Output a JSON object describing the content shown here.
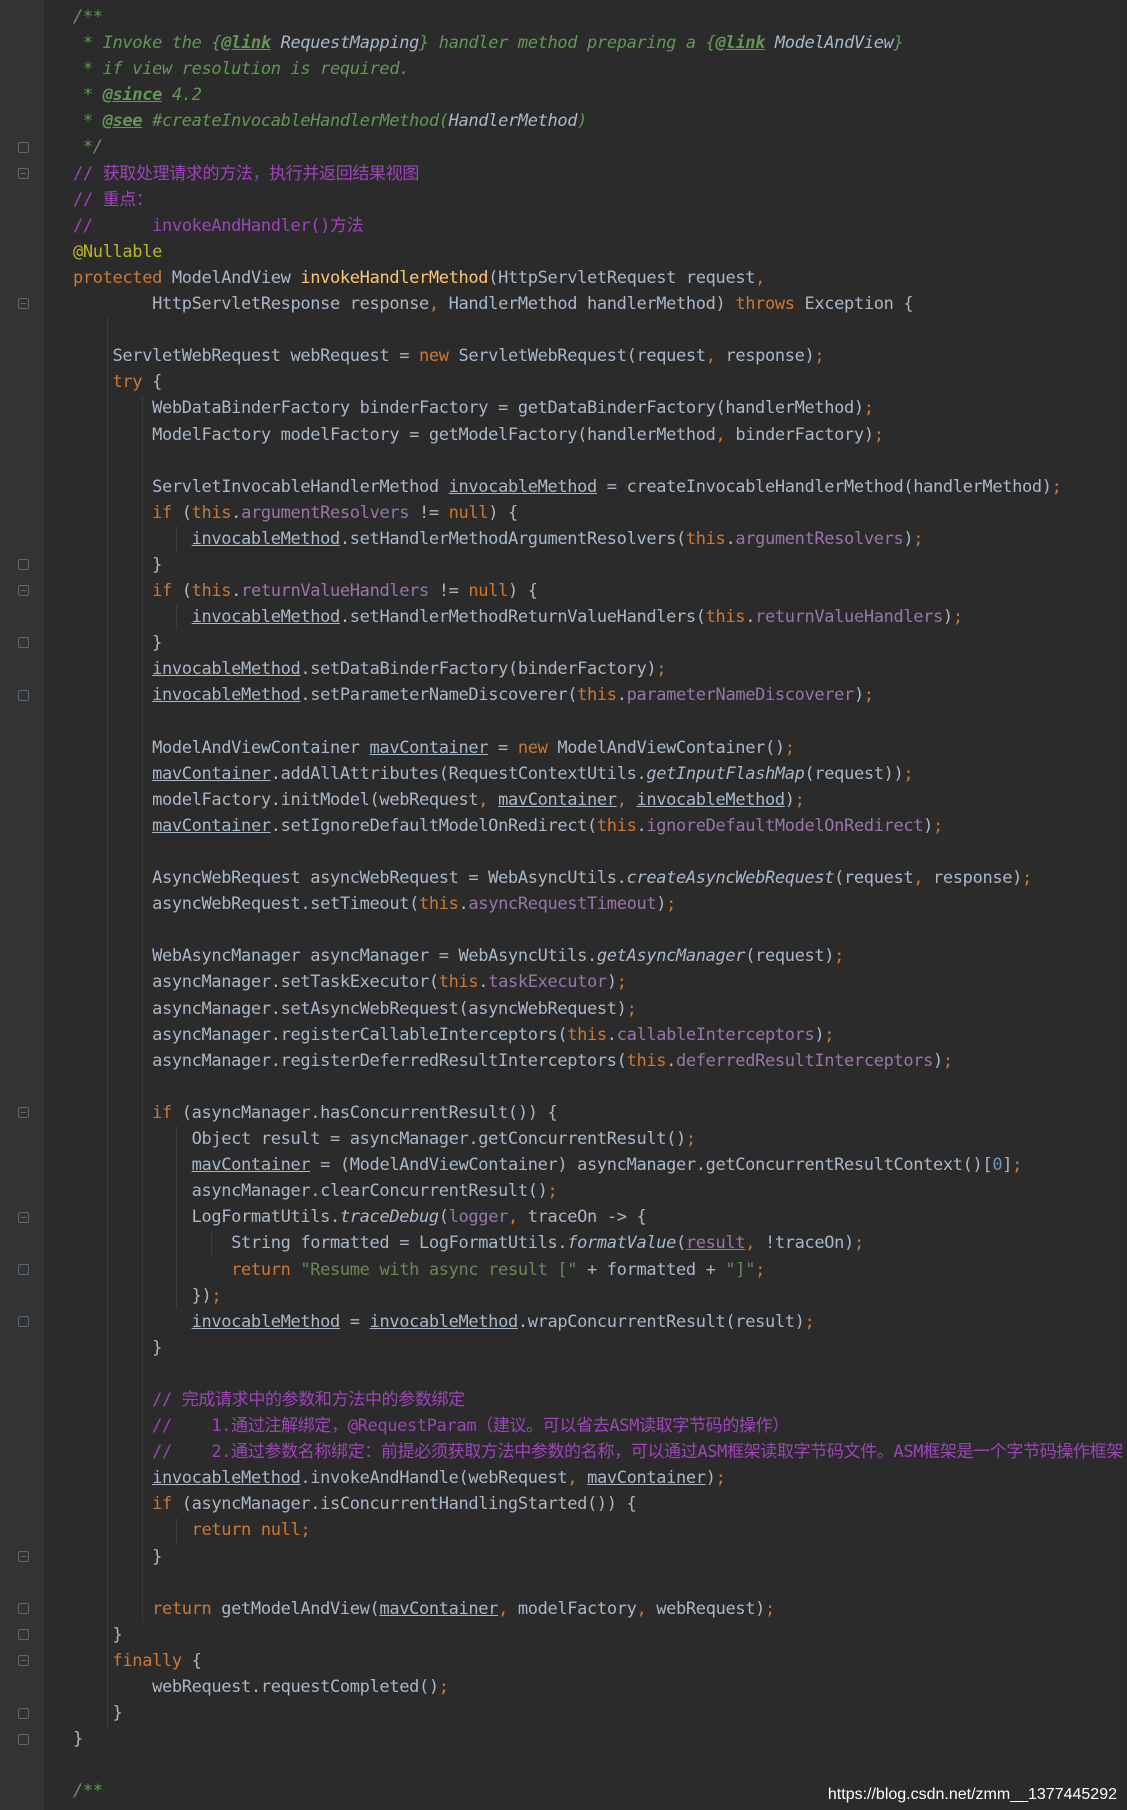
{
  "editor": {
    "language": "java",
    "theme": "darcula",
    "lines": [
      [
        [
          "dc",
          "/**"
        ]
      ],
      [
        [
          "dc",
          " * Invoke the {"
        ],
        [
          "dt",
          "@link"
        ],
        [
          "dc",
          " "
        ],
        [
          "dr",
          "RequestMapping"
        ],
        [
          "dc",
          "} handler method preparing a {"
        ],
        [
          "dt",
          "@link"
        ],
        [
          "dc",
          " "
        ],
        [
          "dr",
          "ModelAndView"
        ],
        [
          "dc",
          "}"
        ]
      ],
      [
        [
          "dc",
          " * if view resolution is required."
        ]
      ],
      [
        [
          "dc",
          " * "
        ],
        [
          "dt",
          "@since"
        ],
        [
          "dc",
          " 4.2"
        ]
      ],
      [
        [
          "dc",
          " * "
        ],
        [
          "dt",
          "@see"
        ],
        [
          "dc",
          " #createInvocableHandlerMethod("
        ],
        [
          "dr",
          "HandlerMethod"
        ],
        [
          "dc",
          ")"
        ]
      ],
      [
        [
          "dc",
          " */"
        ]
      ],
      [
        [
          "cs",
          "// 获取处理请求的方法，执行并返回结果视图"
        ]
      ],
      [
        [
          "cs",
          "// 重点："
        ]
      ],
      [
        [
          "cs",
          "//      invokeAndHandler()方法"
        ]
      ],
      [
        [
          "a",
          "@Nullable"
        ]
      ],
      [
        [
          "k",
          "protected "
        ],
        [
          "t",
          "ModelAndView "
        ],
        [
          "m",
          "invokeHandlerMethod"
        ],
        [
          "t",
          "(HttpServletRequest request"
        ],
        [
          "k",
          ","
        ]
      ],
      [
        [
          "t",
          "        HttpServletResponse response"
        ],
        [
          "k",
          ", "
        ],
        [
          "t",
          "HandlerMethod handlerMethod) "
        ],
        [
          "k",
          "throws "
        ],
        [
          "t",
          "Exception {"
        ]
      ],
      [],
      [
        [
          "t",
          "    ServletWebRequest webRequest = "
        ],
        [
          "k",
          "new "
        ],
        [
          "t",
          "ServletWebRequest(request"
        ],
        [
          "k",
          ", "
        ],
        [
          "t",
          "response)"
        ],
        [
          "k",
          ";"
        ]
      ],
      [
        [
          "k",
          "    try "
        ],
        [
          "t",
          "{"
        ]
      ],
      [
        [
          "t",
          "        WebDataBinderFactory binderFactory = getDataBinderFactory(handlerMethod)"
        ],
        [
          "k",
          ";"
        ]
      ],
      [
        [
          "t",
          "        ModelFactory modelFactory = getModelFactory(handlerMethod"
        ],
        [
          "k",
          ", "
        ],
        [
          "t",
          "binderFactory)"
        ],
        [
          "k",
          ";"
        ]
      ],
      [],
      [
        [
          "t",
          "        ServletInvocableHandlerMethod "
        ],
        [
          "t u",
          "invocableMethod"
        ],
        [
          "t",
          " = createInvocableHandlerMethod(handlerMethod)"
        ],
        [
          "k",
          ";"
        ]
      ],
      [
        [
          "k",
          "        if "
        ],
        [
          "t",
          "("
        ],
        [
          "k",
          "this"
        ],
        [
          "t",
          "."
        ],
        [
          "f",
          "argumentResolvers "
        ],
        [
          "t",
          "!= "
        ],
        [
          "k",
          "null"
        ],
        [
          "t",
          ") {"
        ]
      ],
      [
        [
          "t",
          "            "
        ],
        [
          "t u",
          "invocableMethod"
        ],
        [
          "t",
          ".setHandlerMethodArgumentResolvers("
        ],
        [
          "k",
          "this"
        ],
        [
          "t",
          "."
        ],
        [
          "f",
          "argumentResolvers"
        ],
        [
          "t",
          ")"
        ],
        [
          "k",
          ";"
        ]
      ],
      [
        [
          "t",
          "        }"
        ]
      ],
      [
        [
          "k",
          "        if "
        ],
        [
          "t",
          "("
        ],
        [
          "k",
          "this"
        ],
        [
          "t",
          "."
        ],
        [
          "f",
          "returnValueHandlers "
        ],
        [
          "t",
          "!= "
        ],
        [
          "k",
          "null"
        ],
        [
          "t",
          ") {"
        ]
      ],
      [
        [
          "t",
          "            "
        ],
        [
          "t u",
          "invocableMethod"
        ],
        [
          "t",
          ".setHandlerMethodReturnValueHandlers("
        ],
        [
          "k",
          "this"
        ],
        [
          "t",
          "."
        ],
        [
          "f",
          "returnValueHandlers"
        ],
        [
          "t",
          ")"
        ],
        [
          "k",
          ";"
        ]
      ],
      [
        [
          "t",
          "        }"
        ]
      ],
      [
        [
          "t",
          "        "
        ],
        [
          "t u",
          "invocableMethod"
        ],
        [
          "t",
          ".setDataBinderFactory(binderFactory)"
        ],
        [
          "k",
          ";"
        ]
      ],
      [
        [
          "t",
          "        "
        ],
        [
          "t u",
          "invocableMethod"
        ],
        [
          "t",
          ".setParameterNameDiscoverer("
        ],
        [
          "k",
          "this"
        ],
        [
          "t",
          "."
        ],
        [
          "f",
          "parameterNameDiscoverer"
        ],
        [
          "t",
          ")"
        ],
        [
          "k",
          ";"
        ]
      ],
      [],
      [
        [
          "t",
          "        ModelAndViewContainer "
        ],
        [
          "t u",
          "mavContainer"
        ],
        [
          "t",
          " = "
        ],
        [
          "k",
          "new "
        ],
        [
          "t",
          "ModelAndViewContainer()"
        ],
        [
          "k",
          ";"
        ]
      ],
      [
        [
          "t",
          "        "
        ],
        [
          "t u",
          "mavContainer"
        ],
        [
          "t",
          ".addAllAttributes(RequestContextUtils."
        ],
        [
          "t i",
          "getInputFlashMap"
        ],
        [
          "t",
          "(request))"
        ],
        [
          "k",
          ";"
        ]
      ],
      [
        [
          "t",
          "        modelFactory.initModel(webRequest"
        ],
        [
          "k",
          ", "
        ],
        [
          "t u",
          "mavContainer"
        ],
        [
          "k",
          ", "
        ],
        [
          "t u",
          "invocableMethod"
        ],
        [
          "t",
          ")"
        ],
        [
          "k",
          ";"
        ]
      ],
      [
        [
          "t",
          "        "
        ],
        [
          "t u",
          "mavContainer"
        ],
        [
          "t",
          ".setIgnoreDefaultModelOnRedirect("
        ],
        [
          "k",
          "this"
        ],
        [
          "t",
          "."
        ],
        [
          "f",
          "ignoreDefaultModelOnRedirect"
        ],
        [
          "t",
          ")"
        ],
        [
          "k",
          ";"
        ]
      ],
      [],
      [
        [
          "t",
          "        AsyncWebRequest asyncWebRequest = WebAsyncUtils."
        ],
        [
          "t i",
          "createAsyncWebRequest"
        ],
        [
          "t",
          "(request"
        ],
        [
          "k",
          ", "
        ],
        [
          "t",
          "response)"
        ],
        [
          "k",
          ";"
        ]
      ],
      [
        [
          "t",
          "        asyncWebRequest.setTimeout("
        ],
        [
          "k",
          "this"
        ],
        [
          "t",
          "."
        ],
        [
          "f",
          "asyncRequestTimeout"
        ],
        [
          "t",
          ")"
        ],
        [
          "k",
          ";"
        ]
      ],
      [],
      [
        [
          "t",
          "        WebAsyncManager asyncManager = WebAsyncUtils."
        ],
        [
          "t i",
          "getAsyncManager"
        ],
        [
          "t",
          "(request)"
        ],
        [
          "k",
          ";"
        ]
      ],
      [
        [
          "t",
          "        asyncManager.setTaskExecutor("
        ],
        [
          "k",
          "this"
        ],
        [
          "t",
          "."
        ],
        [
          "f",
          "taskExecutor"
        ],
        [
          "t",
          ")"
        ],
        [
          "k",
          ";"
        ]
      ],
      [
        [
          "t",
          "        asyncManager.setAsyncWebRequest(asyncWebRequest)"
        ],
        [
          "k",
          ";"
        ]
      ],
      [
        [
          "t",
          "        asyncManager.registerCallableInterceptors("
        ],
        [
          "k",
          "this"
        ],
        [
          "t",
          "."
        ],
        [
          "f",
          "callableInterceptors"
        ],
        [
          "t",
          ")"
        ],
        [
          "k",
          ";"
        ]
      ],
      [
        [
          "t",
          "        asyncManager.registerDeferredResultInterceptors("
        ],
        [
          "k",
          "this"
        ],
        [
          "t",
          "."
        ],
        [
          "f",
          "deferredResultInterceptors"
        ],
        [
          "t",
          ")"
        ],
        [
          "k",
          ";"
        ]
      ],
      [],
      [
        [
          "k",
          "        if "
        ],
        [
          "t",
          "(asyncManager.hasConcurrentResult()) {"
        ]
      ],
      [
        [
          "t",
          "            Object result = asyncManager.getConcurrentResult()"
        ],
        [
          "k",
          ";"
        ]
      ],
      [
        [
          "t",
          "            "
        ],
        [
          "t u",
          "mavContainer"
        ],
        [
          "t",
          " = (ModelAndViewContainer) asyncManager.getConcurrentResultContext()["
        ],
        [
          "n",
          "0"
        ],
        [
          "t",
          "]"
        ],
        [
          "k",
          ";"
        ]
      ],
      [
        [
          "t",
          "            asyncManager.clearConcurrentResult()"
        ],
        [
          "k",
          ";"
        ]
      ],
      [
        [
          "t",
          "            LogFormatUtils."
        ],
        [
          "t i",
          "traceDebug"
        ],
        [
          "t",
          "("
        ],
        [
          "f",
          "logger"
        ],
        [
          "k",
          ", "
        ],
        [
          "t",
          "traceOn -> {"
        ]
      ],
      [
        [
          "t",
          "                String formatted = LogFormatUtils."
        ],
        [
          "t i",
          "formatValue"
        ],
        [
          "t",
          "("
        ],
        [
          "f u",
          "result"
        ],
        [
          "k",
          ", "
        ],
        [
          "t",
          "!traceOn)"
        ],
        [
          "k",
          ";"
        ]
      ],
      [
        [
          "k",
          "                return "
        ],
        [
          "s",
          "\"Resume with async result [\" "
        ],
        [
          "t",
          "+ formatted + "
        ],
        [
          "s",
          "\"]\""
        ],
        [
          "k",
          ";"
        ]
      ],
      [
        [
          "t",
          "            })"
        ],
        [
          "k",
          ";"
        ]
      ],
      [
        [
          "t",
          "            "
        ],
        [
          "t u",
          "invocableMethod"
        ],
        [
          "t",
          " = "
        ],
        [
          "t u",
          "invocableMethod"
        ],
        [
          "t",
          ".wrapConcurrentResult(result)"
        ],
        [
          "k",
          ";"
        ]
      ],
      [
        [
          "t",
          "        }"
        ]
      ],
      [],
      [
        [
          "cs",
          "        // 完成请求中的参数和方法中的参数绑定"
        ]
      ],
      [
        [
          "cs",
          "        //    1.通过注解绑定，@RequestParam（建议。可以省去ASM读取字节码的操作）"
        ]
      ],
      [
        [
          "cs",
          "        //    2.通过参数名称绑定：前提必须获取方法中参数的名称，可以通过ASM框架读取字节码文件。ASM框架是一个字节码操作框架"
        ]
      ],
      [
        [
          "t",
          "        "
        ],
        [
          "t u",
          "invocableMethod"
        ],
        [
          "t",
          ".invokeAndHandle(webRequest"
        ],
        [
          "k",
          ", "
        ],
        [
          "t u",
          "mavContainer"
        ],
        [
          "t",
          ")"
        ],
        [
          "k",
          ";"
        ]
      ],
      [
        [
          "k",
          "        if "
        ],
        [
          "t",
          "(asyncManager.isConcurrentHandlingStarted()) {"
        ]
      ],
      [
        [
          "k",
          "            return null;"
        ]
      ],
      [
        [
          "t",
          "        }"
        ]
      ],
      [],
      [
        [
          "k",
          "        return "
        ],
        [
          "t",
          "getModelAndView("
        ],
        [
          "t u",
          "mavContainer"
        ],
        [
          "k",
          ", "
        ],
        [
          "t",
          "modelFactory"
        ],
        [
          "k",
          ", "
        ],
        [
          "t",
          "webRequest)"
        ],
        [
          "k",
          ";"
        ]
      ],
      [
        [
          "t",
          "    }"
        ]
      ],
      [
        [
          "k",
          "    finally "
        ],
        [
          "t",
          "{"
        ]
      ],
      [
        [
          "t",
          "        webRequest.requestCompleted()"
        ],
        [
          "k",
          ";"
        ]
      ],
      [
        [
          "t",
          "    }"
        ]
      ],
      [
        [
          "t",
          "}"
        ]
      ],
      [],
      [
        [
          "dc",
          "/**"
        ]
      ]
    ]
  },
  "watermark": "https://blog.csdn.net/zmm__1377445292"
}
